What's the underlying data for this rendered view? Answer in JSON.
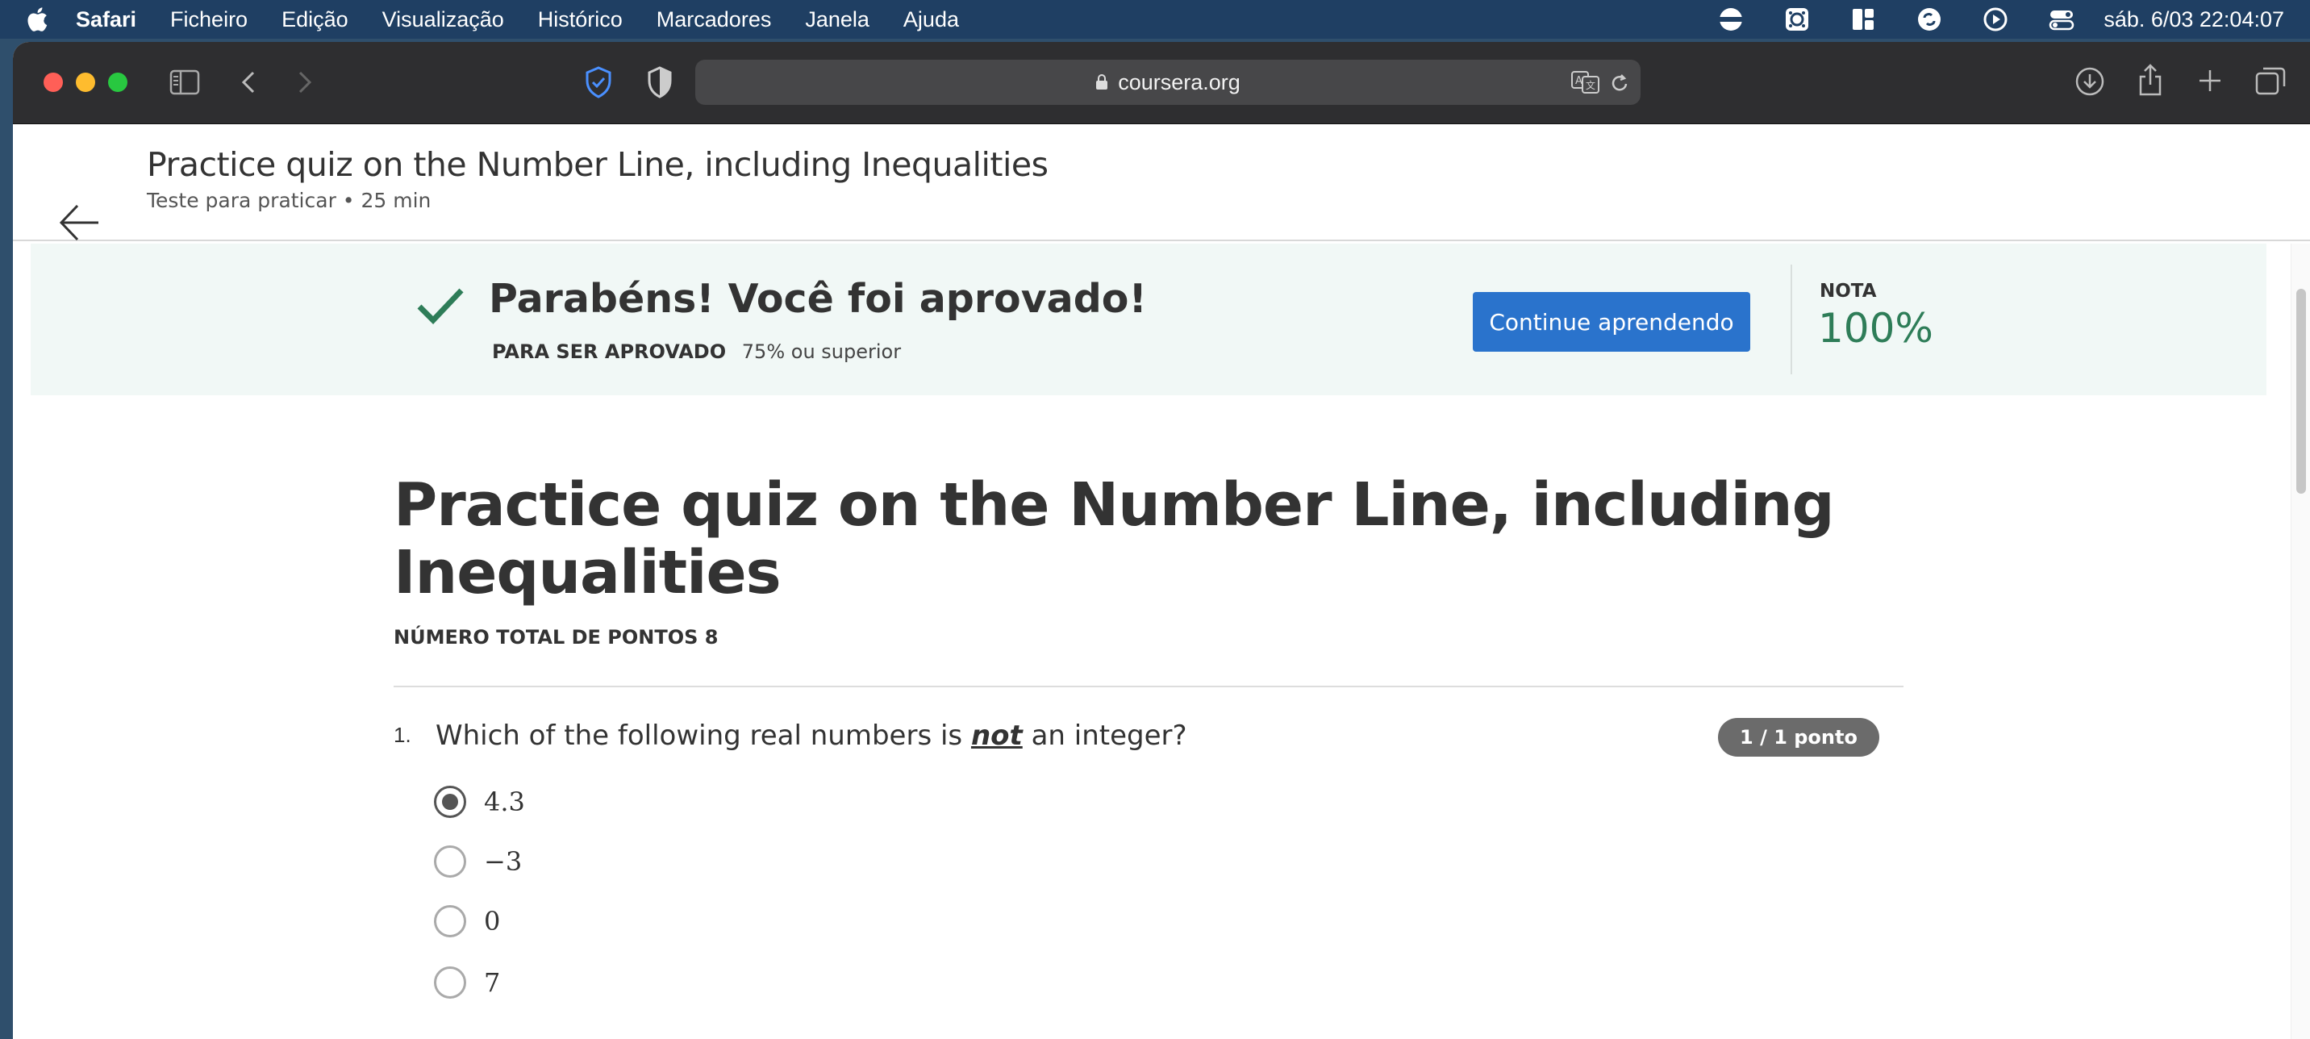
{
  "menubar": {
    "items": [
      "Safari",
      "Ficheiro",
      "Edição",
      "Visualização",
      "Histórico",
      "Marcadores",
      "Janela",
      "Ajuda"
    ],
    "clock": "sáb. 6/03  22:04:07",
    "status_icons": [
      "flag-icon",
      "menu-extra-icon",
      "layout-icon",
      "sync-icon",
      "play-icon",
      "control-center-icon"
    ]
  },
  "browser": {
    "url": "coursera.org",
    "traffic_colors": [
      "#ff5f57",
      "#febc2e",
      "#28c840"
    ]
  },
  "header": {
    "title": "Practice quiz on the Number Line, including Inequalities",
    "subtitle": "Teste para praticar • 25 min"
  },
  "banner": {
    "message": "Parabéns! Você foi aprovado!",
    "pass_label": "PARA SER APROVADO",
    "pass_value": "75% ou superior",
    "continue_button": "Continue aprendendo",
    "grade_label": "NOTA",
    "grade_value": "100%",
    "accent": "#2e7d58",
    "button_color": "#2a73cc"
  },
  "quiz": {
    "title": "Practice quiz on the Number Line, including Inequalities",
    "total_points": "NÚMERO TOTAL DE PONTOS 8",
    "questions": [
      {
        "number": "1.",
        "text_before": "Which of the following real numbers is ",
        "text_emph": "not",
        "text_after": " an integer?",
        "score": "1 / 1 ponto",
        "options": [
          {
            "label": "4.3",
            "selected": true
          },
          {
            "label": "−3",
            "selected": false
          },
          {
            "label": "0",
            "selected": false
          },
          {
            "label": "7",
            "selected": false
          }
        ]
      }
    ]
  }
}
